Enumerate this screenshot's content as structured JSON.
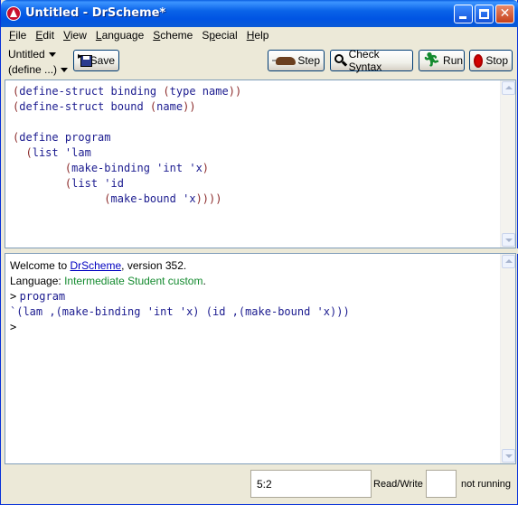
{
  "window": {
    "title": "Untitled - DrScheme*"
  },
  "menu": {
    "items": [
      {
        "label": "File",
        "accel": "F",
        "rest": "ile"
      },
      {
        "label": "Edit",
        "accel": "E",
        "rest": "dit"
      },
      {
        "label": "View",
        "accel": "V",
        "rest": "iew"
      },
      {
        "label": "Language",
        "accel": "L",
        "rest": "anguage"
      },
      {
        "label": "Scheme",
        "accel": "S",
        "rest": "cheme"
      },
      {
        "label": "Special",
        "accel": "p",
        "pre": "S",
        "rest": "ecial"
      },
      {
        "label": "Help",
        "accel": "H",
        "rest": "elp"
      }
    ]
  },
  "toolbar": {
    "file_menu_label": "Untitled",
    "define_menu_label": "(define ...)",
    "save_label": "Save",
    "step_label": "Step",
    "check_syntax_label": "Check Syntax",
    "run_label": "Run",
    "stop_label": "Stop"
  },
  "definitions": {
    "lines": [
      "(define-struct binding (type name))",
      "(define-struct bound (name))",
      "",
      "(define program",
      "  (list 'lam",
      "        (make-binding 'int 'x)",
      "        (list 'id",
      "              (make-bound 'x))))"
    ]
  },
  "interactions": {
    "welcome_prefix": "Welcome to ",
    "welcome_link": "DrScheme",
    "welcome_suffix": ", version 352.",
    "language_prefix": "Language: ",
    "language_name": "Intermediate Student custom",
    "language_suffix": ".",
    "prompt1": ">",
    "input1": "program",
    "output1": "`(lam ,(make-binding 'int 'x) (id ,(make-bound 'x)))",
    "prompt2": ">"
  },
  "status": {
    "position": "5:2",
    "mode": "Read/Write",
    "running_state": "not running"
  },
  "colors": {
    "titlebar": "#0054e3",
    "code_text": "#1b1b8f",
    "language_name": "#138a2e",
    "link": "#0000c0",
    "stop_red": "#d40000"
  }
}
